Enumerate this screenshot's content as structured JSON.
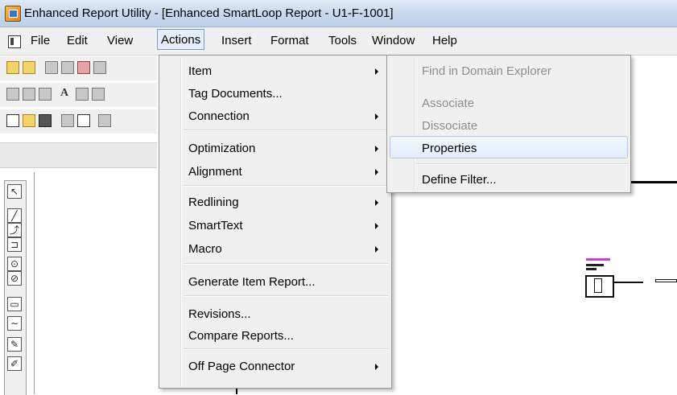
{
  "window": {
    "title": "Enhanced Report Utility - [Enhanced SmartLoop Report - U1-F-1001]",
    "icon": "app-icon"
  },
  "menubar": {
    "items": [
      "File",
      "Edit",
      "View",
      "Actions",
      "Insert",
      "Format",
      "Tools",
      "Window",
      "Help"
    ],
    "active": "Actions"
  },
  "actions_menu": {
    "items": [
      {
        "label": "Item",
        "submenu": true
      },
      {
        "label": "Tag Documents...",
        "submenu": false
      },
      {
        "label": "Connection",
        "submenu": true
      },
      {
        "label": "Optimization",
        "submenu": true
      },
      {
        "label": "Alignment",
        "submenu": true
      },
      {
        "label": "Redlining",
        "submenu": true
      },
      {
        "label": "SmartText",
        "submenu": true
      },
      {
        "label": "Macro",
        "submenu": true
      },
      {
        "label": "Generate Item Report...",
        "submenu": false
      },
      {
        "label": "Revisions...",
        "submenu": false
      },
      {
        "label": "Compare Reports...",
        "submenu": false
      },
      {
        "label": "Off Page Connector",
        "submenu": true
      }
    ]
  },
  "item_submenu": {
    "items": [
      {
        "label": "Find in Domain Explorer",
        "enabled": false
      },
      {
        "label": "Associate",
        "enabled": false
      },
      {
        "label": "Dissociate",
        "enabled": false
      },
      {
        "label": "Properties",
        "enabled": true,
        "highlighted": true
      },
      {
        "label": "Define Filter...",
        "enabled": true
      }
    ]
  },
  "colors": {
    "highlight_border": "#a8caf0",
    "disabled_text": "#8d8d8d",
    "symbol_accent": "#d23fd0"
  }
}
